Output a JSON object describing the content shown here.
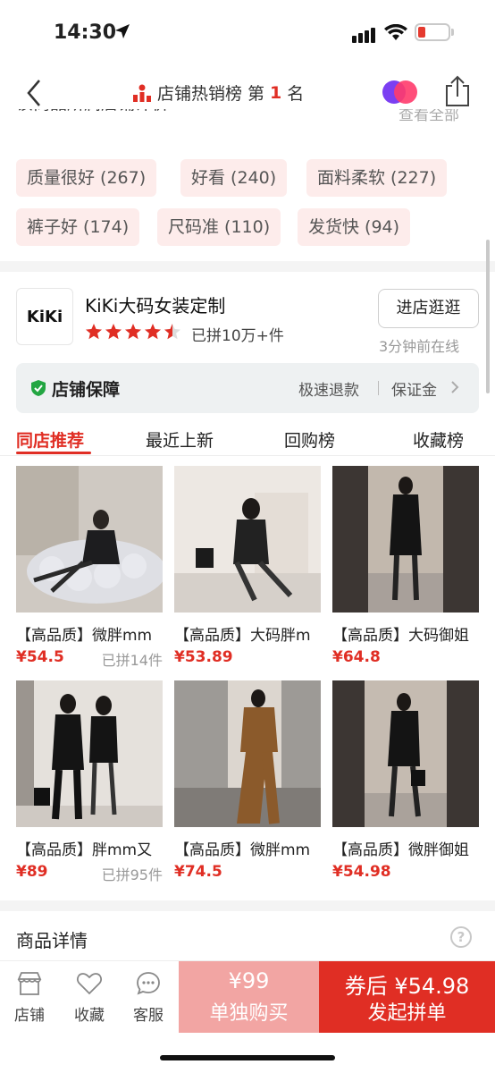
{
  "status_bar": {
    "time": "14:30"
  },
  "nav": {
    "title": "店铺热销榜",
    "rank_prefix": "第",
    "rank_num": "1",
    "rank_suffix": "名"
  },
  "cut_section": {
    "heading": "该商品所属店铺评价",
    "view_all": "查看全部"
  },
  "review_tags": [
    {
      "label": "质量很好 (267)"
    },
    {
      "label": "好看 (240)"
    },
    {
      "label": "面料柔软 (227)"
    },
    {
      "label": "裤子好 (174)"
    },
    {
      "label": "尺码准 (110)"
    },
    {
      "label": "发货快 (94)"
    }
  ],
  "shop": {
    "logo_text": "KiKi",
    "name": "KiKi大码女装定制",
    "rating_stars": 4.5,
    "sold": "已拼10万+件",
    "visit_btn": "进店逛逛",
    "online": "3分钟前在线"
  },
  "guarantee": {
    "title": "店铺保障",
    "item1": "极速退款",
    "item2": "保证金"
  },
  "tabs": [
    {
      "label": "同店推荐"
    },
    {
      "label": "最近上新"
    },
    {
      "label": "回购榜"
    },
    {
      "label": "收藏榜"
    }
  ],
  "products": [
    {
      "name": "【高品质】微胖mm",
      "price": "¥54.5",
      "sold": "已拼14件"
    },
    {
      "name": "【高品质】大码胖m",
      "price": "¥53.89",
      "sold": ""
    },
    {
      "name": "【高品质】大码御姐",
      "price": "¥64.8",
      "sold": ""
    },
    {
      "name": "【高品质】胖mm又",
      "price": "¥89",
      "sold": "已拼95件"
    },
    {
      "name": "【高品质】微胖mm",
      "price": "¥74.5",
      "sold": ""
    },
    {
      "name": "【高品质】微胖御姐",
      "price": "¥54.98",
      "sold": ""
    }
  ],
  "detail": {
    "title": "商品详情",
    "help": "?"
  },
  "bottom_bar": {
    "shop": "店铺",
    "fav": "收藏",
    "service": "客服",
    "single_price": "¥99",
    "single_label": "单独购买",
    "group_price": "券后 ¥54.98",
    "group_label": "发起拼单"
  },
  "colors": {
    "accent": "#e02e24",
    "tag_bg": "#fdeceb",
    "single_btn": "#f2a5a3"
  }
}
